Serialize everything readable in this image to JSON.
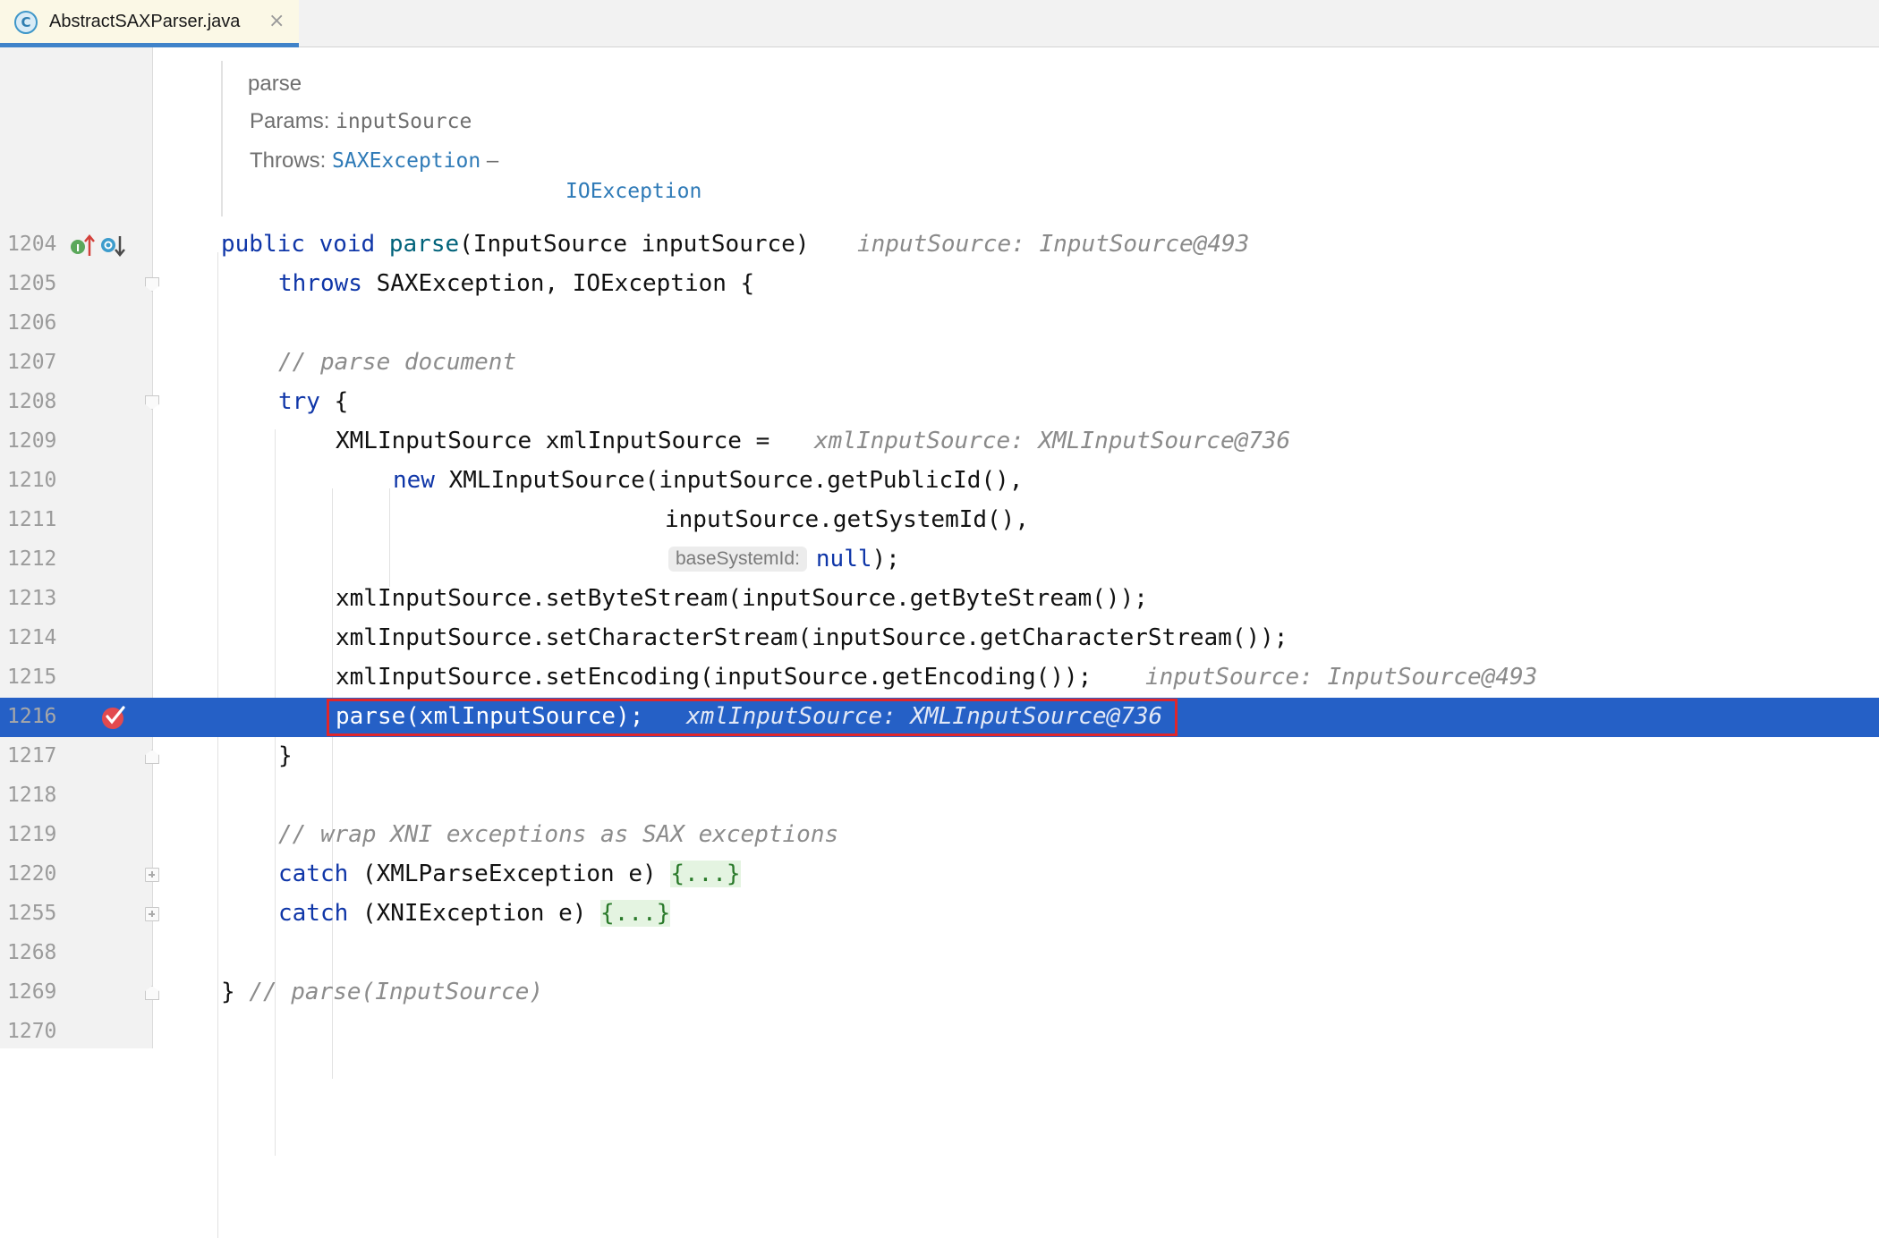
{
  "tab": {
    "icon": "class-c-icon",
    "letter": "C",
    "filename": "AbstractSAXParser.java",
    "close": "×"
  },
  "doc": {
    "title": "parse",
    "params_label": "Params:",
    "params_value": "inputSource",
    "throws_label": "Throws:",
    "throws_value_1": "SAXException",
    "throws_dash": " –",
    "throws_value_2": "IOException"
  },
  "lines": [
    {
      "n": "1204",
      "tokens": [
        {
          "t": "kw",
          "s": "public"
        },
        {
          "t": "plain",
          "s": " "
        },
        {
          "t": "kw",
          "s": "void"
        },
        {
          "t": "plain",
          "s": " "
        },
        {
          "t": "fn",
          "s": "parse"
        },
        {
          "t": "plain",
          "s": "(InputSource inputSource)"
        }
      ],
      "hint": "inputSource: InputSource@493"
    },
    {
      "n": "1205",
      "tokens": [
        {
          "t": "kw",
          "s": "throws"
        },
        {
          "t": "plain",
          "s": " SAXException, IOException {"
        }
      ]
    },
    {
      "n": "1206",
      "tokens": []
    },
    {
      "n": "1207",
      "tokens": [
        {
          "t": "cm",
          "s": "// parse document"
        }
      ]
    },
    {
      "n": "1208",
      "tokens": [
        {
          "t": "kw",
          "s": "try"
        },
        {
          "t": "plain",
          "s": " {"
        }
      ]
    },
    {
      "n": "1209",
      "tokens": [
        {
          "t": "plain",
          "s": "XMLInputSource xmlInputSource ="
        }
      ],
      "hint": "xmlInputSource: XMLInputSource@736"
    },
    {
      "n": "1210",
      "tokens": [
        {
          "t": "kw",
          "s": "new"
        },
        {
          "t": "plain",
          "s": " XMLInputSource(inputSource.getPublicId(),"
        }
      ]
    },
    {
      "n": "1211",
      "tokens": [
        {
          "t": "plain",
          "s": "inputSource.getSystemId(),"
        }
      ]
    },
    {
      "n": "1212",
      "param_hint": "baseSystemId:",
      "tokens": [
        {
          "t": "kw",
          "s": "null"
        },
        {
          "t": "plain",
          "s": ");"
        }
      ]
    },
    {
      "n": "1213",
      "tokens": [
        {
          "t": "plain",
          "s": "xmlInputSource.setByteStream(inputSource.getByteStream());"
        }
      ]
    },
    {
      "n": "1214",
      "tokens": [
        {
          "t": "plain",
          "s": "xmlInputSource.setCharacterStream(inputSource.getCharacterStream());"
        }
      ]
    },
    {
      "n": "1215",
      "tokens": [
        {
          "t": "plain",
          "s": "xmlInputSource.setEncoding(inputSource.getEncoding());"
        }
      ],
      "hint": "inputSource: InputSource@493"
    },
    {
      "n": "1216",
      "tokens": [
        {
          "t": "plain",
          "s": "parse(xmlInputSource);"
        }
      ],
      "hint": "xmlInputSource: XMLInputSource@736"
    },
    {
      "n": "1217",
      "tokens": [
        {
          "t": "plain",
          "s": "}"
        }
      ]
    },
    {
      "n": "1218",
      "tokens": []
    },
    {
      "n": "1219",
      "tokens": [
        {
          "t": "cm",
          "s": "// wrap XNI exceptions as SAX exceptions"
        }
      ]
    },
    {
      "n": "1220",
      "tokens": [
        {
          "t": "kw",
          "s": "catch"
        },
        {
          "t": "plain",
          "s": " (XMLParseException e) "
        },
        {
          "t": "fold",
          "s": "{...}"
        }
      ]
    },
    {
      "n": "1255",
      "tokens": [
        {
          "t": "kw",
          "s": "catch"
        },
        {
          "t": "plain",
          "s": " (XNIException e) "
        },
        {
          "t": "fold",
          "s": "{...}"
        }
      ]
    },
    {
      "n": "1268",
      "tokens": []
    },
    {
      "n": "1269",
      "tokens": [
        {
          "t": "plain",
          "s": "} "
        },
        {
          "t": "cm",
          "s": "// parse(InputSource)"
        }
      ]
    },
    {
      "n": "1270",
      "tokens": []
    }
  ],
  "current_line": "1216",
  "gutter_icons": {
    "1204": [
      "implements-up-icon",
      "overridden-down-icon"
    ],
    "1216": [
      "breakpoint-hit-icon"
    ]
  },
  "colors": {
    "current_line": "#2560c6",
    "highlight_box": "#e0262b",
    "keyword": "#0f36a8",
    "method": "#00627a",
    "comment": "#8c8c8c"
  }
}
